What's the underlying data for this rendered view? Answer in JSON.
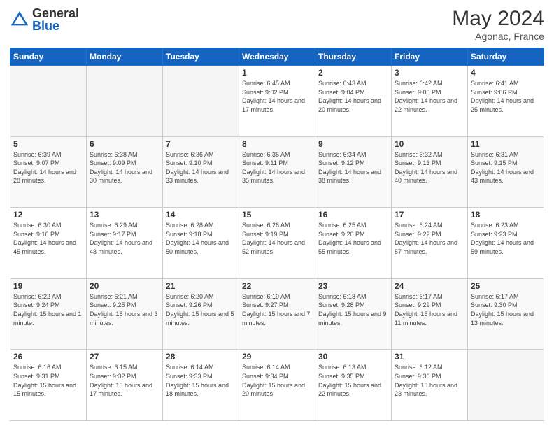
{
  "header": {
    "logo_general": "General",
    "logo_blue": "Blue",
    "month_title": "May 2024",
    "location": "Agonac, France"
  },
  "days_of_week": [
    "Sunday",
    "Monday",
    "Tuesday",
    "Wednesday",
    "Thursday",
    "Friday",
    "Saturday"
  ],
  "weeks": [
    [
      {
        "day": "",
        "info": ""
      },
      {
        "day": "",
        "info": ""
      },
      {
        "day": "",
        "info": ""
      },
      {
        "day": "1",
        "info": "Sunrise: 6:45 AM\nSunset: 9:02 PM\nDaylight: 14 hours and 17 minutes."
      },
      {
        "day": "2",
        "info": "Sunrise: 6:43 AM\nSunset: 9:04 PM\nDaylight: 14 hours and 20 minutes."
      },
      {
        "day": "3",
        "info": "Sunrise: 6:42 AM\nSunset: 9:05 PM\nDaylight: 14 hours and 22 minutes."
      },
      {
        "day": "4",
        "info": "Sunrise: 6:41 AM\nSunset: 9:06 PM\nDaylight: 14 hours and 25 minutes."
      }
    ],
    [
      {
        "day": "5",
        "info": "Sunrise: 6:39 AM\nSunset: 9:07 PM\nDaylight: 14 hours and 28 minutes."
      },
      {
        "day": "6",
        "info": "Sunrise: 6:38 AM\nSunset: 9:09 PM\nDaylight: 14 hours and 30 minutes."
      },
      {
        "day": "7",
        "info": "Sunrise: 6:36 AM\nSunset: 9:10 PM\nDaylight: 14 hours and 33 minutes."
      },
      {
        "day": "8",
        "info": "Sunrise: 6:35 AM\nSunset: 9:11 PM\nDaylight: 14 hours and 35 minutes."
      },
      {
        "day": "9",
        "info": "Sunrise: 6:34 AM\nSunset: 9:12 PM\nDaylight: 14 hours and 38 minutes."
      },
      {
        "day": "10",
        "info": "Sunrise: 6:32 AM\nSunset: 9:13 PM\nDaylight: 14 hours and 40 minutes."
      },
      {
        "day": "11",
        "info": "Sunrise: 6:31 AM\nSunset: 9:15 PM\nDaylight: 14 hours and 43 minutes."
      }
    ],
    [
      {
        "day": "12",
        "info": "Sunrise: 6:30 AM\nSunset: 9:16 PM\nDaylight: 14 hours and 45 minutes."
      },
      {
        "day": "13",
        "info": "Sunrise: 6:29 AM\nSunset: 9:17 PM\nDaylight: 14 hours and 48 minutes."
      },
      {
        "day": "14",
        "info": "Sunrise: 6:28 AM\nSunset: 9:18 PM\nDaylight: 14 hours and 50 minutes."
      },
      {
        "day": "15",
        "info": "Sunrise: 6:26 AM\nSunset: 9:19 PM\nDaylight: 14 hours and 52 minutes."
      },
      {
        "day": "16",
        "info": "Sunrise: 6:25 AM\nSunset: 9:20 PM\nDaylight: 14 hours and 55 minutes."
      },
      {
        "day": "17",
        "info": "Sunrise: 6:24 AM\nSunset: 9:22 PM\nDaylight: 14 hours and 57 minutes."
      },
      {
        "day": "18",
        "info": "Sunrise: 6:23 AM\nSunset: 9:23 PM\nDaylight: 14 hours and 59 minutes."
      }
    ],
    [
      {
        "day": "19",
        "info": "Sunrise: 6:22 AM\nSunset: 9:24 PM\nDaylight: 15 hours and 1 minute."
      },
      {
        "day": "20",
        "info": "Sunrise: 6:21 AM\nSunset: 9:25 PM\nDaylight: 15 hours and 3 minutes."
      },
      {
        "day": "21",
        "info": "Sunrise: 6:20 AM\nSunset: 9:26 PM\nDaylight: 15 hours and 5 minutes."
      },
      {
        "day": "22",
        "info": "Sunrise: 6:19 AM\nSunset: 9:27 PM\nDaylight: 15 hours and 7 minutes."
      },
      {
        "day": "23",
        "info": "Sunrise: 6:18 AM\nSunset: 9:28 PM\nDaylight: 15 hours and 9 minutes."
      },
      {
        "day": "24",
        "info": "Sunrise: 6:17 AM\nSunset: 9:29 PM\nDaylight: 15 hours and 11 minutes."
      },
      {
        "day": "25",
        "info": "Sunrise: 6:17 AM\nSunset: 9:30 PM\nDaylight: 15 hours and 13 minutes."
      }
    ],
    [
      {
        "day": "26",
        "info": "Sunrise: 6:16 AM\nSunset: 9:31 PM\nDaylight: 15 hours and 15 minutes."
      },
      {
        "day": "27",
        "info": "Sunrise: 6:15 AM\nSunset: 9:32 PM\nDaylight: 15 hours and 17 minutes."
      },
      {
        "day": "28",
        "info": "Sunrise: 6:14 AM\nSunset: 9:33 PM\nDaylight: 15 hours and 18 minutes."
      },
      {
        "day": "29",
        "info": "Sunrise: 6:14 AM\nSunset: 9:34 PM\nDaylight: 15 hours and 20 minutes."
      },
      {
        "day": "30",
        "info": "Sunrise: 6:13 AM\nSunset: 9:35 PM\nDaylight: 15 hours and 22 minutes."
      },
      {
        "day": "31",
        "info": "Sunrise: 6:12 AM\nSunset: 9:36 PM\nDaylight: 15 hours and 23 minutes."
      },
      {
        "day": "",
        "info": ""
      }
    ]
  ]
}
